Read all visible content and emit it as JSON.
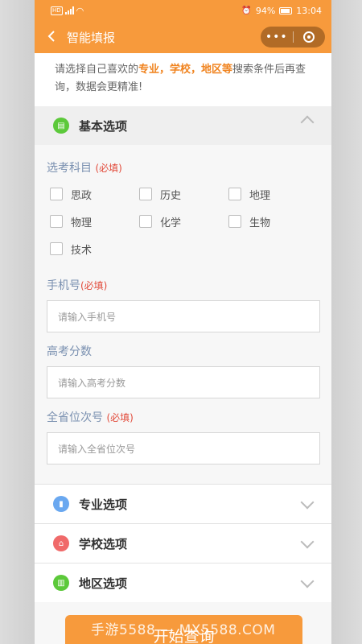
{
  "status": {
    "left": "HD",
    "battery_pct": "94%",
    "time": "13:04"
  },
  "nav": {
    "title": "智能填报",
    "back_icon": "chevron-left-icon",
    "more": "•••"
  },
  "intro": {
    "part1": "请选择自己喜欢的",
    "highlight": "专业，学校，地区等",
    "part2": "搜索条件后再查询，数据会更精准!"
  },
  "basic": {
    "title": "基本选项",
    "subjects_label": "选考科目",
    "required": "(必填)",
    "subjects": [
      "思政",
      "历史",
      "地理",
      "物理",
      "化学",
      "生物",
      "技术"
    ],
    "phone_label": "手机号",
    "phone_required": "(必填)",
    "phone_placeholder": "请输入手机号",
    "score_label": "高考分数",
    "score_placeholder": "请输入高考分数",
    "rank_label": "全省位次号",
    "rank_required": "(必填)",
    "rank_placeholder": "请输入全省位次号"
  },
  "sections": [
    {
      "title": "专业选项",
      "color": "#6aa8f0"
    },
    {
      "title": "学校选项",
      "color": "#f06a6a"
    },
    {
      "title": "地区选项",
      "color": "#5cc93a"
    }
  ],
  "button": {
    "label": "开始查询"
  },
  "watermark": "手游5588 — MX5588.COM",
  "colors": {
    "accent": "#f79a3c",
    "highlight": "#f0831e",
    "required": "#e24a3a",
    "basic_icon": "#5cc93a"
  }
}
